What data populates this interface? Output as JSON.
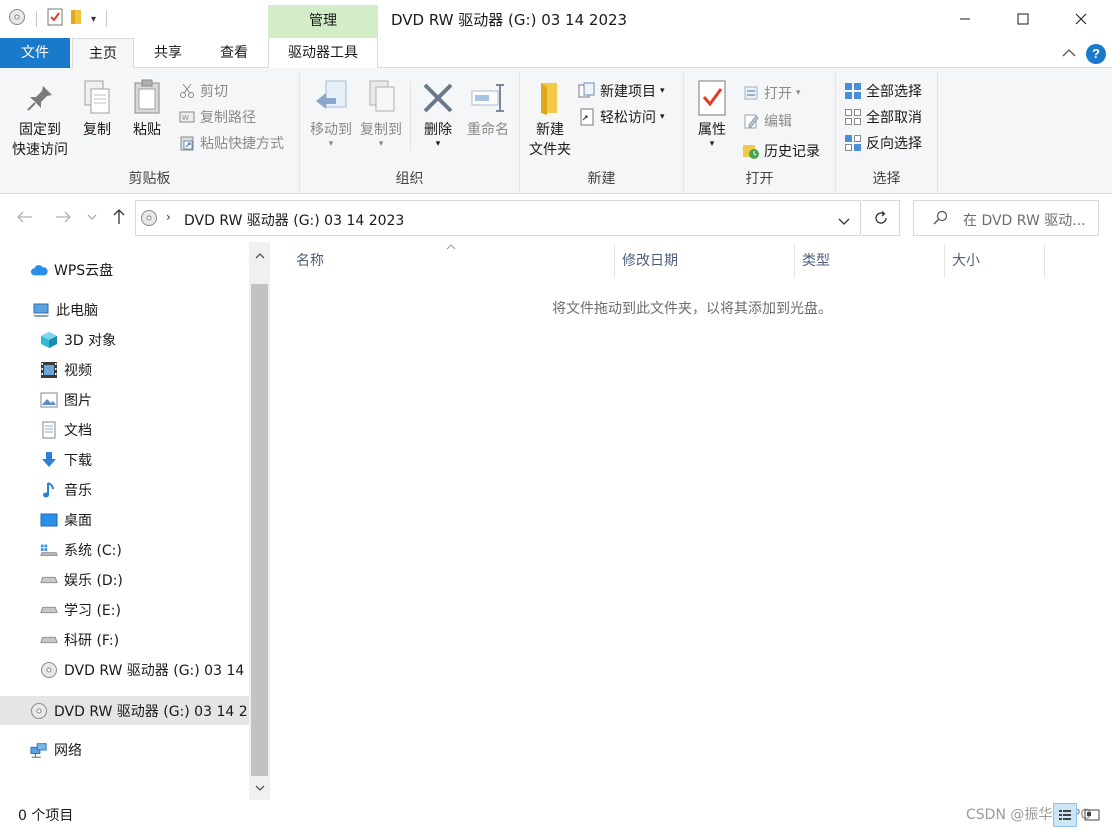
{
  "window": {
    "title": "DVD RW 驱动器 (G:) 03 14 2023",
    "context_tab": "管理"
  },
  "tabs": {
    "file": "文件",
    "home": "主页",
    "share": "共享",
    "view": "查看",
    "drive_tools": "驱动器工具"
  },
  "ribbon": {
    "clipboard": {
      "label": "剪贴板",
      "pin_line1": "固定到",
      "pin_line2": "快速访问",
      "copy": "复制",
      "paste": "粘贴",
      "cut": "剪切",
      "copy_path": "复制路径",
      "paste_shortcut": "粘贴快捷方式"
    },
    "organize": {
      "label": "组织",
      "move_to": "移动到",
      "copy_to": "复制到",
      "delete": "删除",
      "rename": "重命名"
    },
    "new": {
      "label": "新建",
      "new_folder_line1": "新建",
      "new_folder_line2": "文件夹",
      "new_item": "新建项目",
      "easy_access": "轻松访问"
    },
    "open": {
      "label": "打开",
      "properties": "属性",
      "open": "打开",
      "edit": "编辑",
      "history": "历史记录"
    },
    "select": {
      "label": "选择",
      "select_all": "全部选择",
      "select_none": "全部取消",
      "invert": "反向选择"
    }
  },
  "address": {
    "path": "DVD RW 驱动器 (G:) 03 14 2023",
    "search_placeholder": "在 DVD RW 驱动..."
  },
  "nav": {
    "items": [
      {
        "label": "WPS云盘",
        "icon": "cloud-icon"
      },
      {
        "label": "此电脑",
        "icon": "computer-icon"
      },
      {
        "label": "3D 对象",
        "icon": "3d-objects-icon"
      },
      {
        "label": "视频",
        "icon": "video-icon"
      },
      {
        "label": "图片",
        "icon": "pictures-icon"
      },
      {
        "label": "文档",
        "icon": "documents-icon"
      },
      {
        "label": "下载",
        "icon": "downloads-icon"
      },
      {
        "label": "音乐",
        "icon": "music-icon"
      },
      {
        "label": "桌面",
        "icon": "desktop-icon"
      },
      {
        "label": "系统 (C:)",
        "icon": "system-drive-icon"
      },
      {
        "label": "娱乐 (D:)",
        "icon": "drive-icon"
      },
      {
        "label": "学习 (E:)",
        "icon": "drive-icon"
      },
      {
        "label": "科研 (F:)",
        "icon": "drive-icon"
      },
      {
        "label": "DVD RW 驱动器 (G:) 03 14",
        "icon": "dvd-icon"
      },
      {
        "label": "DVD RW 驱动器 (G:) 03 14 2",
        "icon": "dvd-icon"
      },
      {
        "label": "网络",
        "icon": "network-icon"
      }
    ]
  },
  "columns": {
    "name": "名称",
    "modified": "修改日期",
    "type": "类型",
    "size": "大小"
  },
  "content": {
    "empty_message": "将文件拖动到此文件夹，以将其添加到光盘。"
  },
  "status": {
    "item_count": "0 个项目",
    "watermark": "CSDN @振华OPPO"
  },
  "colors": {
    "accent": "#1979ca",
    "context_tab_bg": "#d4edc9",
    "ribbon_bg": "#f5f6f7"
  }
}
